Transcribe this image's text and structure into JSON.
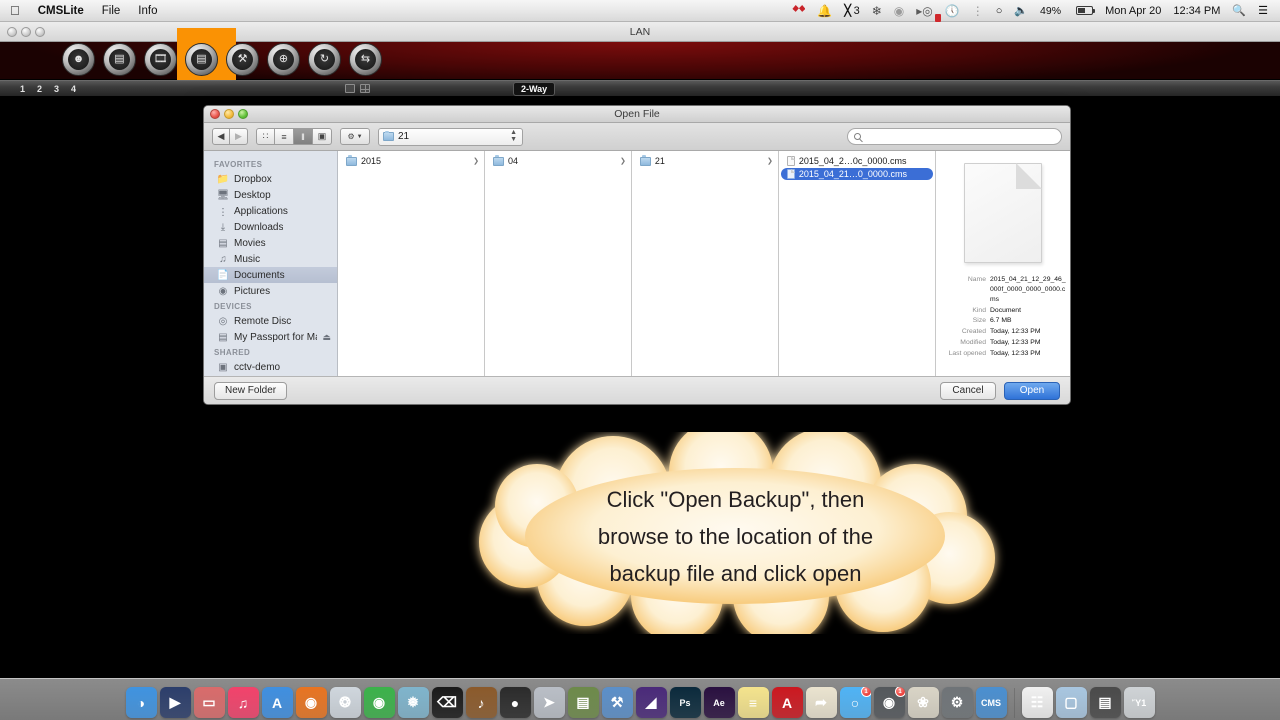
{
  "menubar": {
    "apple": "apple-logo",
    "app_name": "CMSLite",
    "menus": [
      "File",
      "Info"
    ],
    "status_items": [
      {
        "icon": "dropbox-red-icon",
        "label": ""
      },
      {
        "icon": "bell-icon",
        "label": ""
      },
      {
        "icon": "app-badge-icon",
        "label": "3"
      },
      {
        "icon": "dropbox-icon",
        "label": ""
      },
      {
        "icon": "disabled-icon",
        "label": ""
      },
      {
        "icon": "error-badge-icon",
        "label": ""
      },
      {
        "icon": "clock-icon",
        "label": ""
      },
      {
        "icon": "bluetooth-icon",
        "label": ""
      },
      {
        "icon": "wifi-icon",
        "label": ""
      },
      {
        "icon": "volume-icon",
        "label": ""
      }
    ],
    "battery_percent": "49%",
    "date": "Mon Apr 20",
    "time": "12:34 PM",
    "spotlight_icon": "search-icon",
    "notification_icon": "notification-center-icon"
  },
  "cms_window": {
    "title": "LAN",
    "toolbar_buttons": [
      {
        "name": "user-button",
        "glyph": "♟",
        "selected": false
      },
      {
        "name": "device-manager-button",
        "glyph": "▤",
        "selected": false
      },
      {
        "name": "playback-button",
        "glyph": "☰",
        "selected": false
      },
      {
        "name": "open-backup-button",
        "glyph": "▤",
        "selected": true
      },
      {
        "name": "settings-tools-button",
        "glyph": "⚒",
        "selected": false
      },
      {
        "name": "target-button",
        "glyph": "⊕",
        "selected": false
      },
      {
        "name": "refresh-button",
        "glyph": "↻",
        "selected": false
      },
      {
        "name": "sync-button",
        "glyph": "⇄",
        "selected": false
      }
    ],
    "camera_numbers": [
      "1",
      "2",
      "3",
      "4"
    ],
    "layout_single_icon": "single-pane-icon",
    "layout_quad_icon": "quad-pane-icon",
    "mode_label": "2-Way"
  },
  "dialog": {
    "title": "Open File",
    "nav": {
      "back": "◀",
      "forward": "▶"
    },
    "view_modes": [
      {
        "name": "icon-view",
        "glyph": "∷",
        "active": false
      },
      {
        "name": "list-view",
        "glyph": "≡",
        "active": false
      },
      {
        "name": "column-view",
        "glyph": "‖",
        "active": true
      },
      {
        "name": "coverflow-view",
        "glyph": "▣",
        "active": false
      }
    ],
    "action_menu_label": "⚙",
    "path_value": "21",
    "search_placeholder": "",
    "sidebar": {
      "sections": [
        {
          "header": "FAVORITES",
          "items": [
            {
              "label": "Dropbox",
              "icon": "folder-icon",
              "selected": false
            },
            {
              "label": "Desktop",
              "icon": "desktop-icon",
              "selected": false
            },
            {
              "label": "Applications",
              "icon": "applications-icon",
              "selected": false
            },
            {
              "label": "Downloads",
              "icon": "downloads-icon",
              "selected": false
            },
            {
              "label": "Movies",
              "icon": "movies-icon",
              "selected": false
            },
            {
              "label": "Music",
              "icon": "music-icon",
              "selected": false
            },
            {
              "label": "Documents",
              "icon": "documents-icon",
              "selected": true
            },
            {
              "label": "Pictures",
              "icon": "pictures-icon",
              "selected": false
            }
          ]
        },
        {
          "header": "DEVICES",
          "items": [
            {
              "label": "Remote Disc",
              "icon": "disc-icon",
              "selected": false
            },
            {
              "label": "My Passport for Mac",
              "icon": "harddrive-icon",
              "selected": false,
              "eject": "⏏"
            }
          ]
        },
        {
          "header": "SHARED",
          "items": [
            {
              "label": "cctv-demo",
              "icon": "server-icon",
              "selected": false
            }
          ]
        }
      ]
    },
    "columns": [
      {
        "name": "column-year",
        "rows": [
          {
            "label": "2015",
            "type": "folder",
            "selected": false,
            "disclosure": "❯"
          }
        ]
      },
      {
        "name": "column-month",
        "rows": [
          {
            "label": "04",
            "type": "folder",
            "selected": false,
            "disclosure": "❯"
          }
        ]
      },
      {
        "name": "column-day",
        "rows": [
          {
            "label": "21",
            "type": "folder",
            "selected": false,
            "disclosure": "❯"
          }
        ]
      },
      {
        "name": "column-files",
        "rows": [
          {
            "label": "2015_04_2…0c_0000.cms",
            "type": "file",
            "selected": false,
            "disclosure": ""
          },
          {
            "label": "2015_04_21…0_0000.cms",
            "type": "file",
            "selected": true,
            "disclosure": ""
          }
        ]
      }
    ],
    "preview": {
      "icon": "document-preview-icon",
      "metadata": [
        {
          "key": "Name",
          "value": "2015_04_21_12_29_46_000f_0000_0000_0000.cms"
        },
        {
          "key": "Kind",
          "value": "Document"
        },
        {
          "key": "Size",
          "value": "6.7 MB"
        },
        {
          "key": "Created",
          "value": "Today, 12:33 PM"
        },
        {
          "key": "Modified",
          "value": "Today, 12:33 PM"
        },
        {
          "key": "Last opened",
          "value": "Today, 12:33 PM"
        }
      ]
    },
    "footer": {
      "new_folder": "New Folder",
      "cancel": "Cancel",
      "open": "Open"
    }
  },
  "callout": {
    "line1": "Click \"Open Backup\", then",
    "line2": "browse to the location of the",
    "line3": "backup file and click open",
    "fill_color": "#fdefc9",
    "edge_color": "#f5a623"
  },
  "dock": {
    "items": [
      {
        "name": "finder",
        "glyph": "◑",
        "color": "#3f93e0",
        "badge": ""
      },
      {
        "name": "screenflow",
        "glyph": "▶",
        "color": "#2c3e6b",
        "badge": ""
      },
      {
        "name": "airdisplay",
        "glyph": "▭",
        "color": "#d96b6b",
        "badge": ""
      },
      {
        "name": "itunes",
        "glyph": "♫",
        "color": "#f2426b",
        "badge": ""
      },
      {
        "name": "app-store",
        "glyph": "A",
        "color": "#3f8fe0",
        "badge": ""
      },
      {
        "name": "firefox",
        "glyph": "◉",
        "color": "#e87421",
        "badge": ""
      },
      {
        "name": "safari",
        "glyph": "❂",
        "color": "#cfd6dd",
        "badge": ""
      },
      {
        "name": "chrome",
        "glyph": "◉",
        "color": "#3bb24a",
        "badge": ""
      },
      {
        "name": "image-capture",
        "glyph": "❅",
        "color": "#7fb4cc",
        "badge": ""
      },
      {
        "name": "terminal",
        "glyph": "⌫",
        "color": "#1a1a1a",
        "badge": ""
      },
      {
        "name": "garageband",
        "glyph": "♪",
        "color": "#8b5a2b",
        "badge": ""
      },
      {
        "name": "logic",
        "glyph": "●",
        "color": "#2b2b2b",
        "badge": ""
      },
      {
        "name": "launchpad",
        "glyph": "➤",
        "color": "#b9bec6",
        "badge": ""
      },
      {
        "name": "filemaker",
        "glyph": "▤",
        "color": "#6d8a4a",
        "badge": ""
      },
      {
        "name": "xcode",
        "glyph": "⚒",
        "color": "#5b8fc9",
        "badge": ""
      },
      {
        "name": "illustrator",
        "glyph": "◢",
        "color": "#4a2a7a",
        "badge": ""
      },
      {
        "name": "photoshop",
        "glyph": "Ps",
        "color": "#0b2a3c",
        "badge": ""
      },
      {
        "name": "after-effects",
        "glyph": "Ae",
        "color": "#2a1040",
        "badge": ""
      },
      {
        "name": "stickies",
        "glyph": "≡",
        "color": "#f4e38c",
        "badge": ""
      },
      {
        "name": "adobe",
        "glyph": "A",
        "color": "#cc1820",
        "badge": ""
      },
      {
        "name": "maps",
        "glyph": "➦",
        "color": "#eae3cf",
        "badge": ""
      },
      {
        "name": "messages",
        "glyph": "○",
        "color": "#4fb3f5",
        "badge": "1"
      },
      {
        "name": "facetime",
        "glyph": "◉",
        "color": "#54585c",
        "badge": "1"
      },
      {
        "name": "iphoto",
        "glyph": "❀",
        "color": "#d9d4c6",
        "badge": ""
      },
      {
        "name": "disk-utility",
        "glyph": "⚙",
        "color": "#6f7478",
        "badge": ""
      },
      {
        "name": "cmslite",
        "glyph": "CMS",
        "color": "#4a8fd0",
        "badge": ""
      },
      {
        "name": "document-file",
        "glyph": "☷",
        "color": "#f0f0f0",
        "badge": ""
      },
      {
        "name": "downloads-stack",
        "glyph": "▢",
        "color": "#a8c6e0",
        "badge": ""
      },
      {
        "name": "movie-file",
        "glyph": "▤",
        "color": "#4a4a4a",
        "badge": ""
      },
      {
        "name": "trash",
        "glyph": "Ὕ1",
        "color": "#cfd3d6",
        "badge": ""
      }
    ]
  }
}
